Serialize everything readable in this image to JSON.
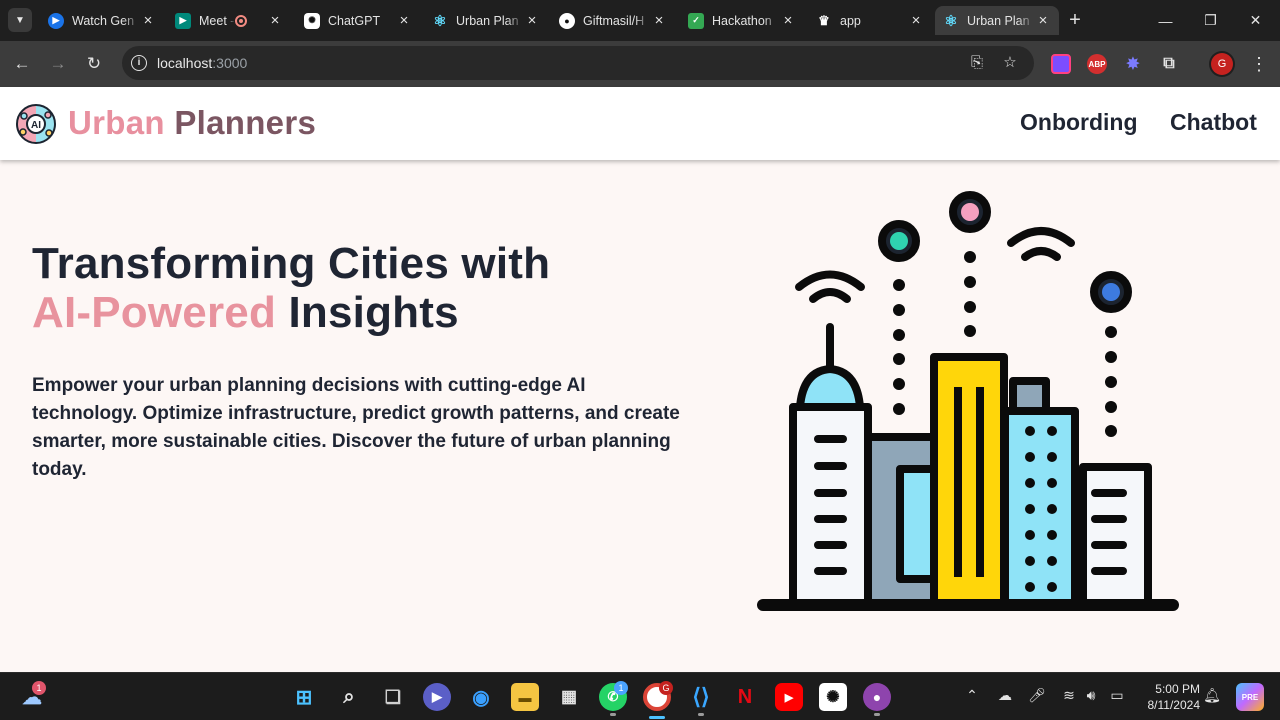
{
  "browser": {
    "tabs": [
      {
        "title": "Watch Gen",
        "favicon": "play-circle-icon",
        "color": "#1a73e8",
        "active": false
      },
      {
        "title": "Meet -",
        "favicon": "meet-icon",
        "color": "#00897b",
        "recording": true,
        "active": false
      },
      {
        "title": "ChatGPT",
        "favicon": "chatgpt-icon",
        "color": "#ffffff",
        "active": false
      },
      {
        "title": "Urban Plan",
        "favicon": "react-icon",
        "color": "#61dafb",
        "active": false
      },
      {
        "title": "Giftmasil/H",
        "favicon": "github-icon",
        "color": "#ffffff",
        "active": false
      },
      {
        "title": "Hackathon",
        "favicon": "hackathon-icon",
        "color": "#34a853",
        "active": false
      },
      {
        "title": "app",
        "favicon": "crown-icon",
        "color": "#ffffff",
        "active": false
      },
      {
        "title": "Urban Plan",
        "favicon": "react-icon",
        "color": "#61dafb",
        "active": true
      }
    ],
    "url_host": "localhost",
    "url_port": ":3000",
    "profile_initial": "G"
  },
  "site": {
    "brand_word1": "Urban",
    "brand_word2": "Planners",
    "logo_text": "AI",
    "nav": [
      "Onbording",
      "Chatbot"
    ],
    "hero_line1": "Transforming Cities with",
    "hero_accent": "AI-Powered",
    "hero_line2_rest": " Insights",
    "hero_description": "Empower your urban planning decisions with cutting-edge AI technology. Optimize infrastructure, predict growth patterns, and create smarter, more sustainable cities. Discover the future of urban planning today.",
    "colors": {
      "brand_pink": "#e8909f",
      "brand_mauve": "#7b5662",
      "text_dark": "#1f2533",
      "background": "#fdf7f5"
    }
  },
  "taskbar": {
    "weather_badge": "1",
    "whatsapp_badge": "1",
    "chrome_badge": "G",
    "time": "5:00 PM",
    "date": "8/11/2024"
  }
}
